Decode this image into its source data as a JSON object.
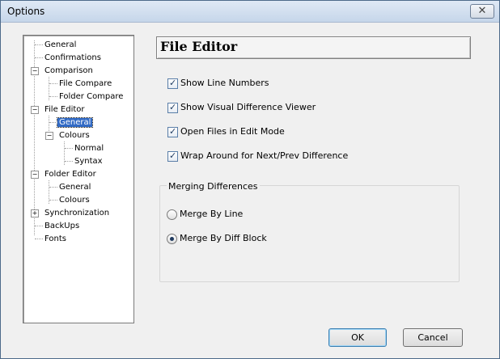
{
  "window": {
    "title": "Options",
    "close_glyph": "✕"
  },
  "tree": {
    "items": [
      {
        "label": "General"
      },
      {
        "label": "Confirmations"
      },
      {
        "label": "Comparison",
        "expander": "−"
      },
      {
        "label": "File Compare"
      },
      {
        "label": "Folder Compare"
      },
      {
        "label": "File Editor",
        "expander": "−"
      },
      {
        "label": "General",
        "selected": true
      },
      {
        "label": "Colours",
        "expander": "−"
      },
      {
        "label": "Normal"
      },
      {
        "label": "Syntax"
      },
      {
        "label": "Folder Editor",
        "expander": "−"
      },
      {
        "label": "General"
      },
      {
        "label": "Colours"
      },
      {
        "label": "Synchronization",
        "expander": "+"
      },
      {
        "label": "BackUps"
      },
      {
        "label": "Fonts"
      }
    ]
  },
  "panel": {
    "title": "File Editor",
    "checkboxes": [
      {
        "label": "Show Line Numbers",
        "checked": true,
        "mark": "✓"
      },
      {
        "label": "Show Visual Difference Viewer",
        "checked": true,
        "mark": "✓"
      },
      {
        "label": "Open Files in Edit Mode",
        "checked": true,
        "mark": "✓"
      },
      {
        "label": "Wrap Around for Next/Prev Difference",
        "checked": true,
        "mark": "✓"
      }
    ],
    "merging": {
      "title": "Merging Differences",
      "options": [
        {
          "label": "Merge By Line",
          "selected": false
        },
        {
          "label": "Merge By Diff Block",
          "selected": true
        }
      ]
    }
  },
  "buttons": {
    "ok": "OK",
    "cancel": "Cancel"
  }
}
